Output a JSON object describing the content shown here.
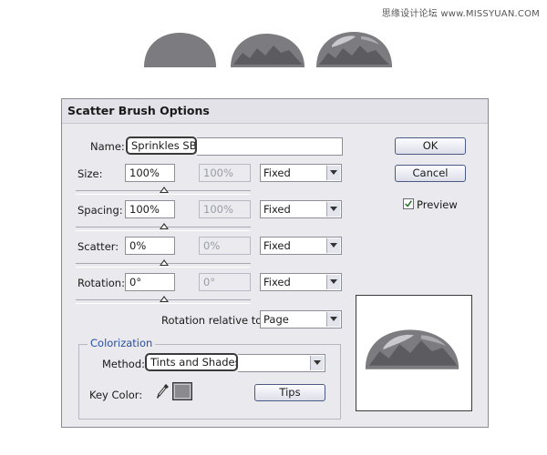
{
  "watermark": "思缘设计论坛 www.MISSYUAN.COM",
  "dialog": {
    "title": "Scatter Brush Options",
    "name_label": "Name:",
    "name_value": "Sprinkles SB",
    "rows": [
      {
        "label": "Size:",
        "value": "100%",
        "max": "100%",
        "mode": "Fixed"
      },
      {
        "label": "Spacing:",
        "value": "100%",
        "max": "100%",
        "mode": "Fixed"
      },
      {
        "label": "Scatter:",
        "value": "0%",
        "max": "0%",
        "mode": "Fixed"
      },
      {
        "label": "Rotation:",
        "value": "0°",
        "max": "0°",
        "mode": "Fixed"
      }
    ],
    "rotation_relative_label": "Rotation relative to:",
    "rotation_relative_value": "Page",
    "colorization": {
      "legend": "Colorization",
      "method_label": "Method:",
      "method_value": "Tints and Shades",
      "key_color_label": "Key Color:",
      "key_color": "#8a8a8f",
      "tips_label": "Tips"
    },
    "ok_label": "OK",
    "cancel_label": "Cancel",
    "preview_label": "Preview",
    "preview_checked": true,
    "eyedropper_icon": "eyedropper-icon"
  }
}
